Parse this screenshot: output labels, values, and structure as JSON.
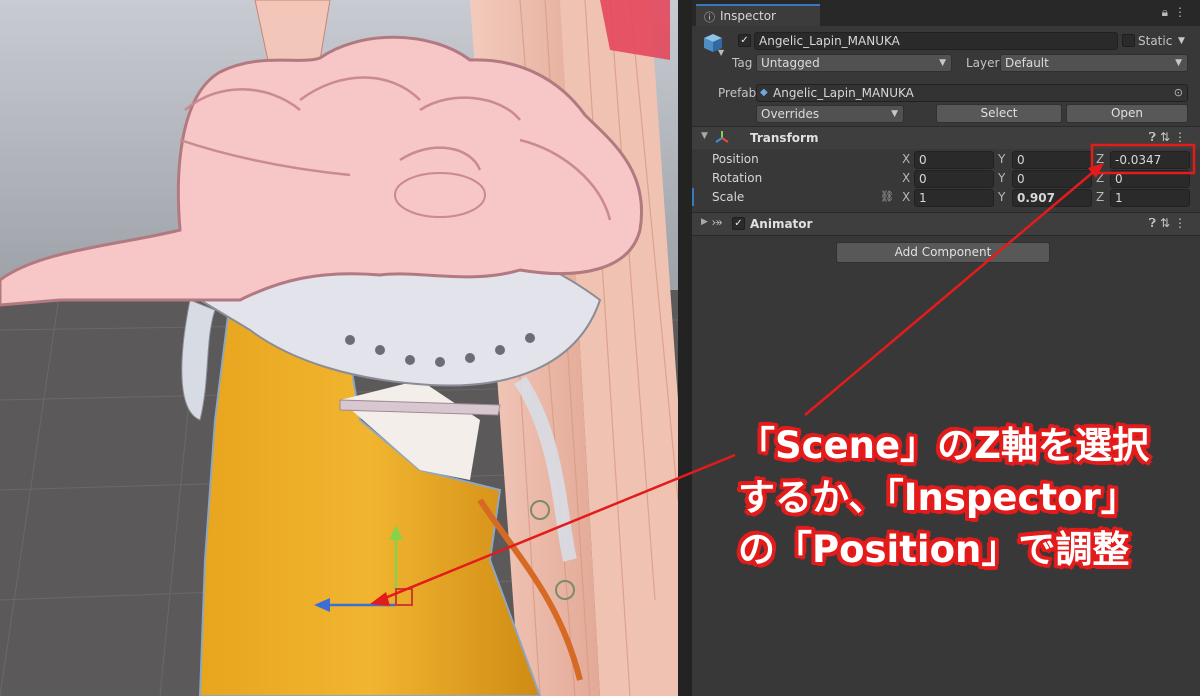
{
  "inspector": {
    "tab_label": "Inspector",
    "tab_icon": "info-icon",
    "object_name": "Angelic_Lapin_MANUKA",
    "static_label": "Static",
    "tag_label": "Tag",
    "tag_value": "Untagged",
    "layer_label": "Layer",
    "layer_value": "Default",
    "prefab_label": "Prefab",
    "prefab_value": "Angelic_Lapin_MANUKA",
    "overrides_label": "Overrides",
    "select_label": "Select",
    "open_label": "Open"
  },
  "transform": {
    "title": "Transform",
    "position_label": "Position",
    "rotation_label": "Rotation",
    "scale_label": "Scale",
    "axis_x": "X",
    "axis_y": "Y",
    "axis_z": "Z",
    "position": {
      "x": "0",
      "y": "0",
      "z": "-0.0347"
    },
    "rotation": {
      "x": "0",
      "y": "0",
      "z": "0"
    },
    "scale": {
      "x": "1",
      "y": "0.907",
      "z": "1"
    }
  },
  "animator": {
    "title": "Animator"
  },
  "add_component_label": "Add Component",
  "annotation": {
    "line1": "「Scene」のZ軸を選択",
    "line2": "するか、「Inspector」",
    "line3": "の「Position」で調整",
    "color": "#e41b1b"
  },
  "colors": {
    "panel_bg": "#383838",
    "field_bg": "#2a2a2a",
    "accent": "#3a79bb",
    "gizmo_y": "#8ad14a",
    "gizmo_z": "#3b6fd6"
  }
}
